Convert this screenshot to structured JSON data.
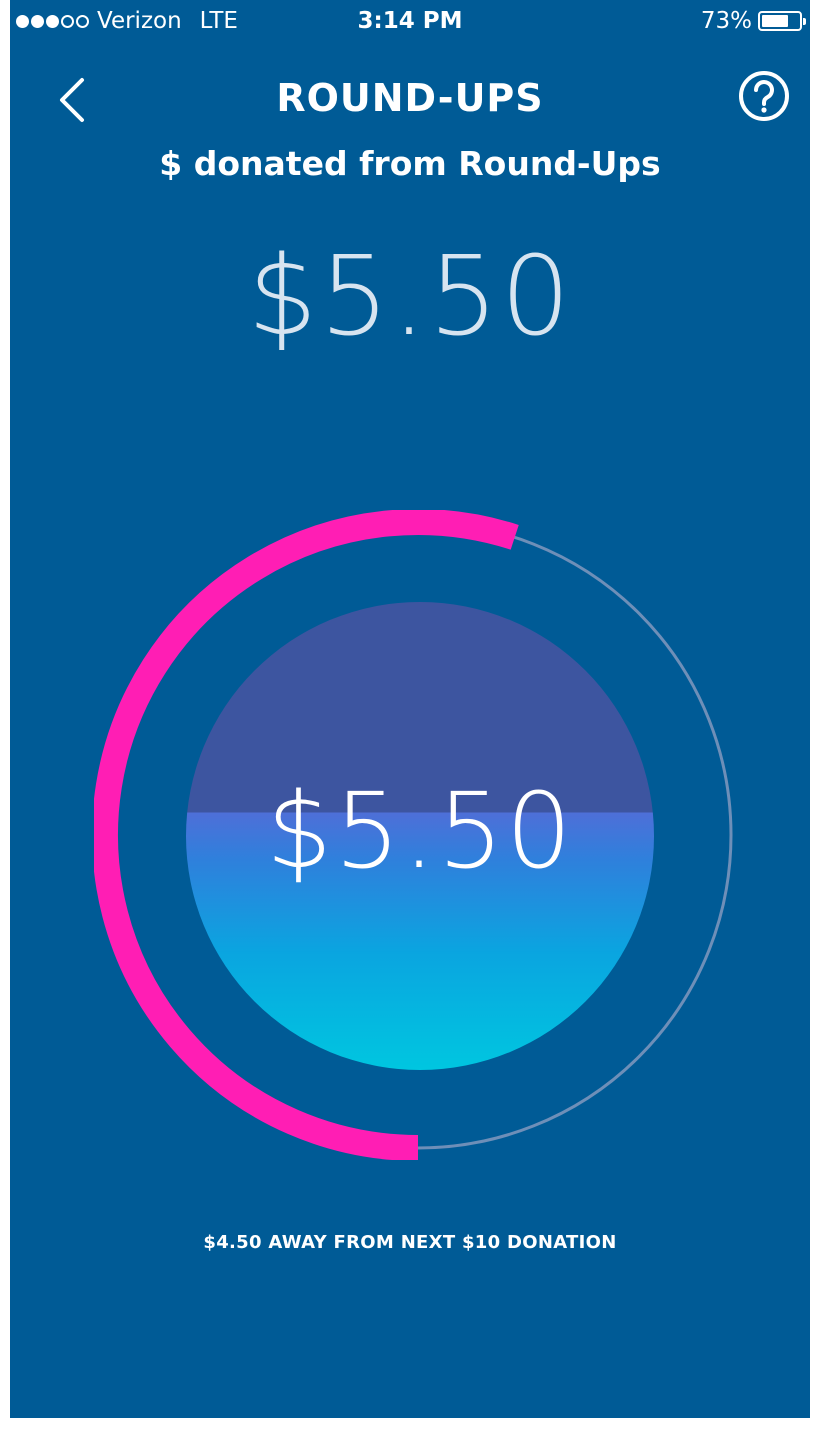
{
  "status_bar": {
    "carrier": "Verizon",
    "network": "LTE",
    "time": "3:14 PM",
    "battery_text": "73%",
    "battery_level": 0.73,
    "signal_bars_filled": 3,
    "signal_bars_total": 5
  },
  "header": {
    "title": "ROUND-UPS",
    "subtitle": "$ donated from Round-Ups",
    "back_icon": "chevron-left-icon",
    "help_icon": "question-circle-icon"
  },
  "summary": {
    "donated_amount": "$5.50"
  },
  "progress": {
    "current_amount": "$5.50",
    "fraction": 0.55,
    "footer_text": "$4.50 AWAY FROM NEXT $10 DONATION"
  },
  "colors": {
    "background": "#005b96",
    "progress_arc": "#ff1eb4",
    "track": "#6e8fb8"
  }
}
